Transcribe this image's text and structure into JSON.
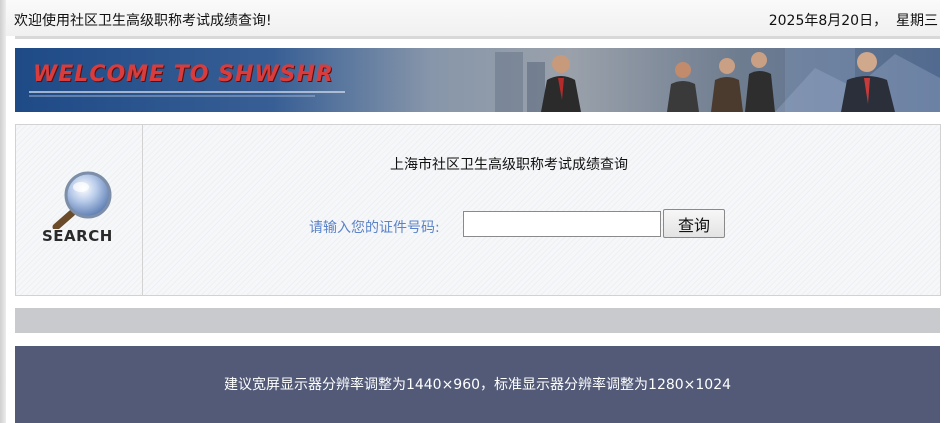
{
  "header": {
    "greeting": "欢迎使用社区卫生高级职称考试成绩查询!",
    "date": "2025年8月20日，  星期三"
  },
  "banner": {
    "welcome_text": "WELCOME TO SHWSHR"
  },
  "search_panel": {
    "logo_text": "SEARCH",
    "title": "上海市社区卫生高级职称考试成绩查询",
    "prompt_label": "请输入您的证件号码:",
    "id_input_value": "",
    "id_input_placeholder": "",
    "query_button_label": "查询"
  },
  "footer": {
    "resolution_note": "建议宽屏显示器分辨率调整为1440×960，标准显示器分辨率调整为1280×1024"
  },
  "colors": {
    "prompt": "#5b83c9",
    "footer_bg": "#525a78",
    "gray_bar": "#c9cacd",
    "welcome_text": "#d93c3c"
  },
  "icons": [
    "magnifier-icon"
  ]
}
